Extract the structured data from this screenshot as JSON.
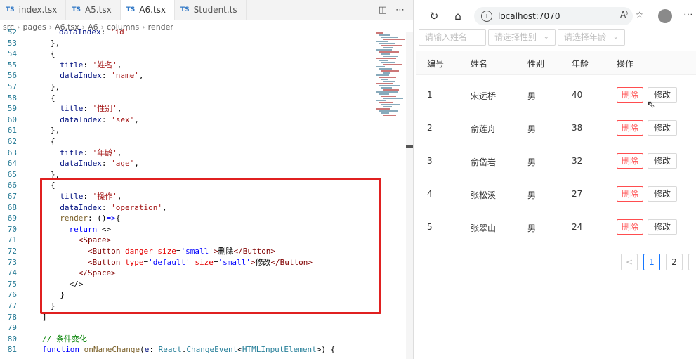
{
  "editor": {
    "tabs": [
      {
        "label": "index.tsx",
        "active": false
      },
      {
        "label": "A5.tsx",
        "active": false
      },
      {
        "label": "A6.tsx",
        "active": true
      },
      {
        "label": "Student.ts",
        "active": false
      }
    ],
    "tab_badge": "TS",
    "breadcrumb": [
      "src",
      "pages",
      "A6.tsx",
      "A6",
      "columns",
      "render"
    ],
    "lines": [
      {
        "n": "52",
        "html": "<span class=\"p\">dataIndex</span>: <span class=\"s\">'id'</span>"
      },
      {
        "n": "53",
        "html": "},"
      },
      {
        "n": "54",
        "html": "{"
      },
      {
        "n": "55",
        "html": "  <span class=\"p\">title</span>: <span class=\"s\">'姓名'</span>,"
      },
      {
        "n": "56",
        "html": "  <span class=\"p\">dataIndex</span>: <span class=\"s\">'name'</span>,"
      },
      {
        "n": "57",
        "html": "},"
      },
      {
        "n": "58",
        "html": "{"
      },
      {
        "n": "59",
        "html": "  <span class=\"p\">title</span>: <span class=\"s\">'性别'</span>,"
      },
      {
        "n": "60",
        "html": "  <span class=\"p\">dataIndex</span>: <span class=\"s\">'sex'</span>,"
      },
      {
        "n": "61",
        "html": "},"
      },
      {
        "n": "62",
        "html": "{"
      },
      {
        "n": "63",
        "html": "  <span class=\"p\">title</span>: <span class=\"s\">'年龄'</span>,"
      },
      {
        "n": "64",
        "html": "  <span class=\"p\">dataIndex</span>: <span class=\"s\">'age'</span>,"
      },
      {
        "n": "65",
        "html": "},"
      },
      {
        "n": "66",
        "html": "{"
      },
      {
        "n": "67",
        "html": "  <span class=\"p\">title</span>: <span class=\"s\">'操作'</span>,"
      },
      {
        "n": "68",
        "html": "  <span class=\"p\">dataIndex</span>: <span class=\"s\">'operation'</span>,"
      },
      {
        "n": "69",
        "html": "  <span class=\"f\">render</span>: ()<span class=\"k\">=&gt;</span>{"
      },
      {
        "n": "70",
        "html": "    <span class=\"k\">return</span> &lt;&gt;"
      },
      {
        "n": "71",
        "html": "      <span class=\"t\">&lt;Space&gt;</span>"
      },
      {
        "n": "72",
        "html": "        <span class=\"t\">&lt;Button</span> <span class=\"a\">danger</span> <span class=\"a\">size</span>=<span class=\"k\">'small'</span><span class=\"t\">&gt;</span>删除<span class=\"t\">&lt;/Button&gt;</span>"
      },
      {
        "n": "73",
        "html": "        <span class=\"t\">&lt;Button</span> <span class=\"a\">type</span>=<span class=\"k\">'default'</span> <span class=\"a\">size</span>=<span class=\"k\">'small'</span><span class=\"t\">&gt;</span>修改<span class=\"t\">&lt;/Button&gt;</span>"
      },
      {
        "n": "74",
        "html": "      <span class=\"t\">&lt;/Space&gt;</span>"
      },
      {
        "n": "75",
        "html": "    &lt;/&gt;"
      },
      {
        "n": "76",
        "html": "  }"
      },
      {
        "n": "77",
        "html": "}"
      },
      {
        "n": "78",
        "html": "]"
      },
      {
        "n": "79",
        "html": ""
      },
      {
        "n": "80",
        "html": "<span class=\"c\">// 条件变化</span>"
      },
      {
        "n": "81",
        "html": "<span class=\"k\">function</span> <span class=\"f\">onNameChange</span>(<span class=\"p\">e</span>: <span class=\"ty\">React</span>.<span class=\"ty\">ChangeEvent</span>&lt;<span class=\"ty\">HTMLInputElement</span>&gt;) {"
      }
    ],
    "highlight_color": "#e02020"
  },
  "browser": {
    "url": "localhost:7070",
    "filters": {
      "name_placeholder": "请输入姓名",
      "sex_placeholder": "请选择性别",
      "age_placeholder": "请选择年龄"
    },
    "table": {
      "headers": [
        "编号",
        "姓名",
        "性别",
        "年龄",
        "操作"
      ],
      "rows": [
        {
          "id": "1",
          "name": "宋远桥",
          "sex": "男",
          "age": "40"
        },
        {
          "id": "2",
          "name": "俞莲舟",
          "sex": "男",
          "age": "38"
        },
        {
          "id": "3",
          "name": "俞岱岩",
          "sex": "男",
          "age": "32"
        },
        {
          "id": "4",
          "name": "张松溪",
          "sex": "男",
          "age": "27"
        },
        {
          "id": "5",
          "name": "张翠山",
          "sex": "男",
          "age": "24"
        }
      ],
      "delete_label": "删除",
      "edit_label": "修改"
    },
    "pagination": {
      "prev": "<",
      "pages": [
        "1",
        "2"
      ],
      "current": "1"
    }
  }
}
